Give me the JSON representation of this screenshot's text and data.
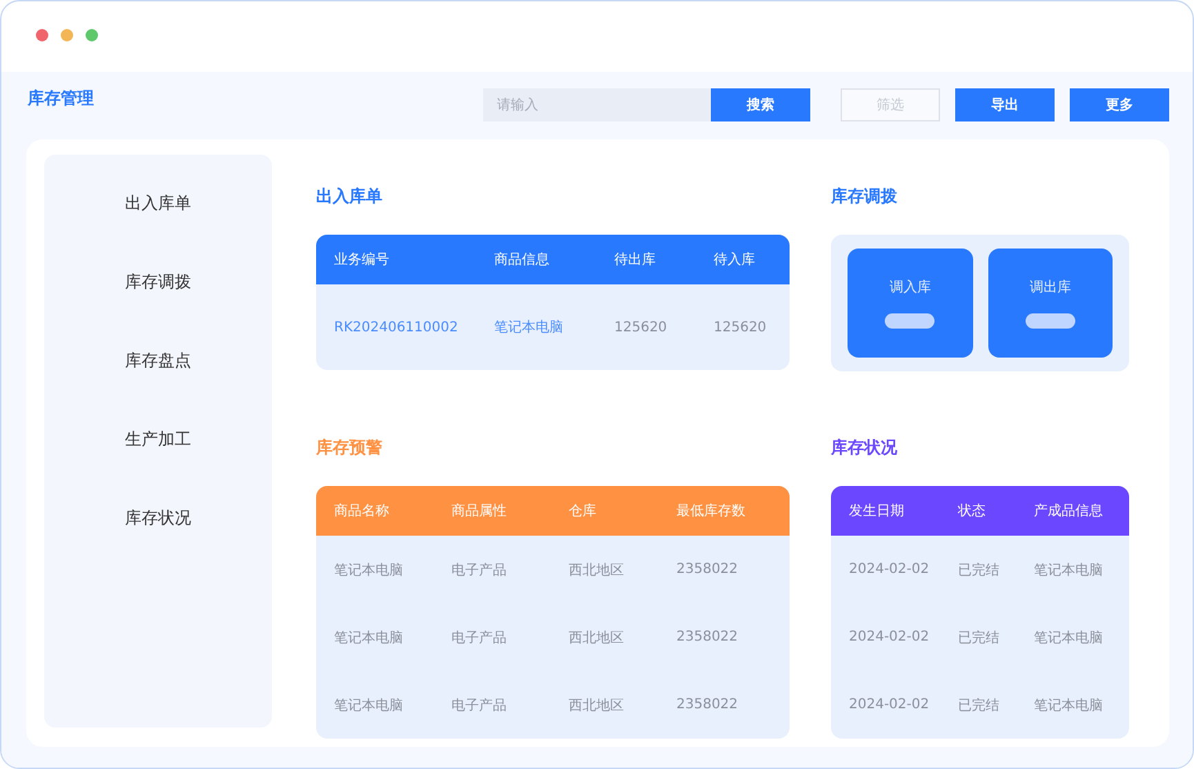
{
  "app_title": "库存管理",
  "search": {
    "placeholder": "请输入"
  },
  "buttons": [
    {
      "label": "搜索",
      "kind": "primary"
    },
    {
      "label": "筛选",
      "kind": "ghost"
    },
    {
      "label": "导出",
      "kind": "primary"
    },
    {
      "label": "更多",
      "kind": "primary"
    }
  ],
  "sidebar": {
    "items": [
      {
        "label": "出入库单"
      },
      {
        "label": "库存调拨"
      },
      {
        "label": "库存盘点"
      },
      {
        "label": "生产加工"
      },
      {
        "label": "库存状况"
      }
    ]
  },
  "sections": [
    {
      "kind": "table",
      "title": "出入库单",
      "color": "#2979ff",
      "columns": [
        {
          "label": "业务编号",
          "link": true
        },
        {
          "label": "商品信息",
          "link": true
        },
        {
          "label": "待出库",
          "link": false
        },
        {
          "label": "待入库",
          "link": false
        }
      ],
      "rows": [
        [
          "RK202406110002",
          "笔记本电脑",
          "125620",
          "125620"
        ]
      ]
    },
    {
      "kind": "transfer",
      "title": "库存调拨",
      "color": "#2979ff",
      "cards": [
        {
          "label": "调入库"
        },
        {
          "label": "调出库"
        }
      ]
    },
    {
      "kind": "table",
      "title": "库存预警",
      "color": "#ff9142",
      "columns": [
        {
          "label": "商品名称",
          "link": false
        },
        {
          "label": "商品属性",
          "link": false
        },
        {
          "label": "仓库",
          "link": false
        },
        {
          "label": "最低库存数",
          "link": false
        }
      ],
      "rows": [
        [
          "笔记本电脑",
          "电子产品",
          "西北地区",
          "2358022"
        ],
        [
          "笔记本电脑",
          "电子产品",
          "西北地区",
          "2358022"
        ],
        [
          "笔记本电脑",
          "电子产品",
          "西北地区",
          "2358022"
        ]
      ]
    },
    {
      "kind": "table",
      "title": "库存状况",
      "color": "#6b48ff",
      "columns": [
        {
          "label": "发生日期",
          "link": false
        },
        {
          "label": "状态",
          "link": false
        },
        {
          "label": "产成品信息",
          "link": false
        }
      ],
      "rows": [
        [
          "2024-02-02",
          "已完结",
          "笔记本电脑"
        ],
        [
          "2024-02-02",
          "已完结",
          "笔记本电脑"
        ],
        [
          "2024-02-02",
          "已完结",
          "笔记本电脑"
        ]
      ]
    }
  ]
}
